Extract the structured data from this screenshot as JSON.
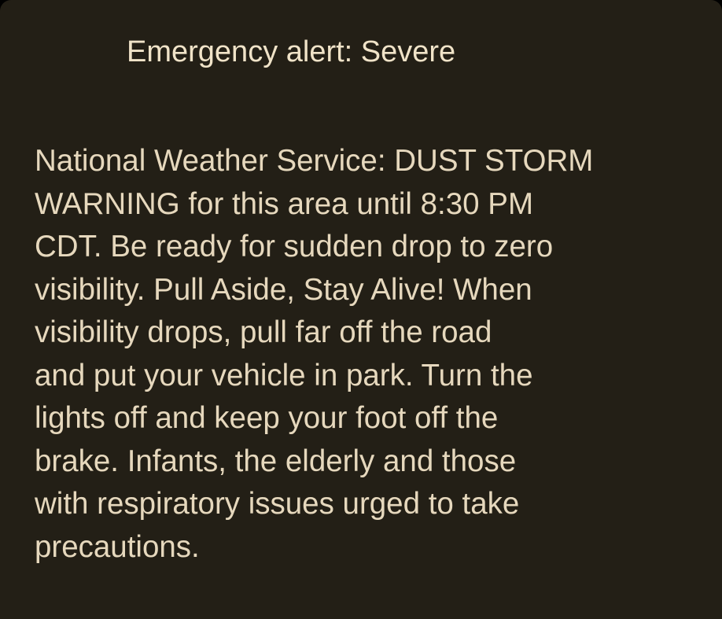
{
  "alert": {
    "title": "Emergency alert: Severe",
    "body_lines": [
      "National Weather Service: DUST STORM",
      "WARNING for this area until 8:30 PM",
      "CDT. Be ready for sudden drop to zero",
      "visibility. Pull Aside, Stay Alive! When",
      "visibility drops, pull far off the road",
      "and put your vehicle in park. Turn the",
      "lights off and keep your foot off the",
      "brake. Infants, the elderly and those",
      "with respiratory issues urged to take",
      "precautions."
    ]
  },
  "colors": {
    "background": "#231f16",
    "title_text": "#f0e3c8",
    "body_text": "#e6d8bd"
  }
}
